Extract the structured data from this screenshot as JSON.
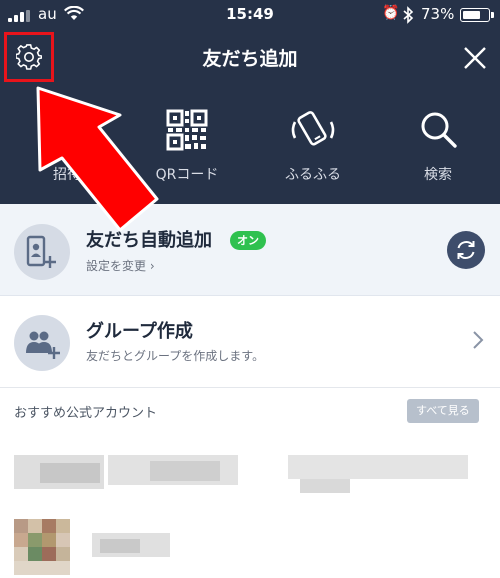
{
  "statusbar": {
    "carrier": "au",
    "time": "15:49",
    "battery_pct": "73%",
    "battery_level": 0.73
  },
  "navbar": {
    "title": "友だち追加",
    "settings_icon": "gear-icon",
    "close_icon": "close-icon"
  },
  "actions": [
    {
      "label": "招待",
      "icon": "invite-icon"
    },
    {
      "label": "QRコード",
      "icon": "qr-code-icon"
    },
    {
      "label": "ふるふる",
      "icon": "shake-phone-icon"
    },
    {
      "label": "検索",
      "icon": "search-icon"
    }
  ],
  "auto_add": {
    "title": "友だち自動追加",
    "badge": "オン",
    "subtitle": "設定を変更 ›"
  },
  "group": {
    "title": "グループ作成",
    "subtitle": "友だちとグループを作成します。"
  },
  "recommended": {
    "header": "おすすめ公式アカウント",
    "see_all": "すべて見る"
  },
  "colors": {
    "header_bg": "#263248",
    "highlight_red": "#e8141b",
    "badge_green": "#2fc14f"
  }
}
